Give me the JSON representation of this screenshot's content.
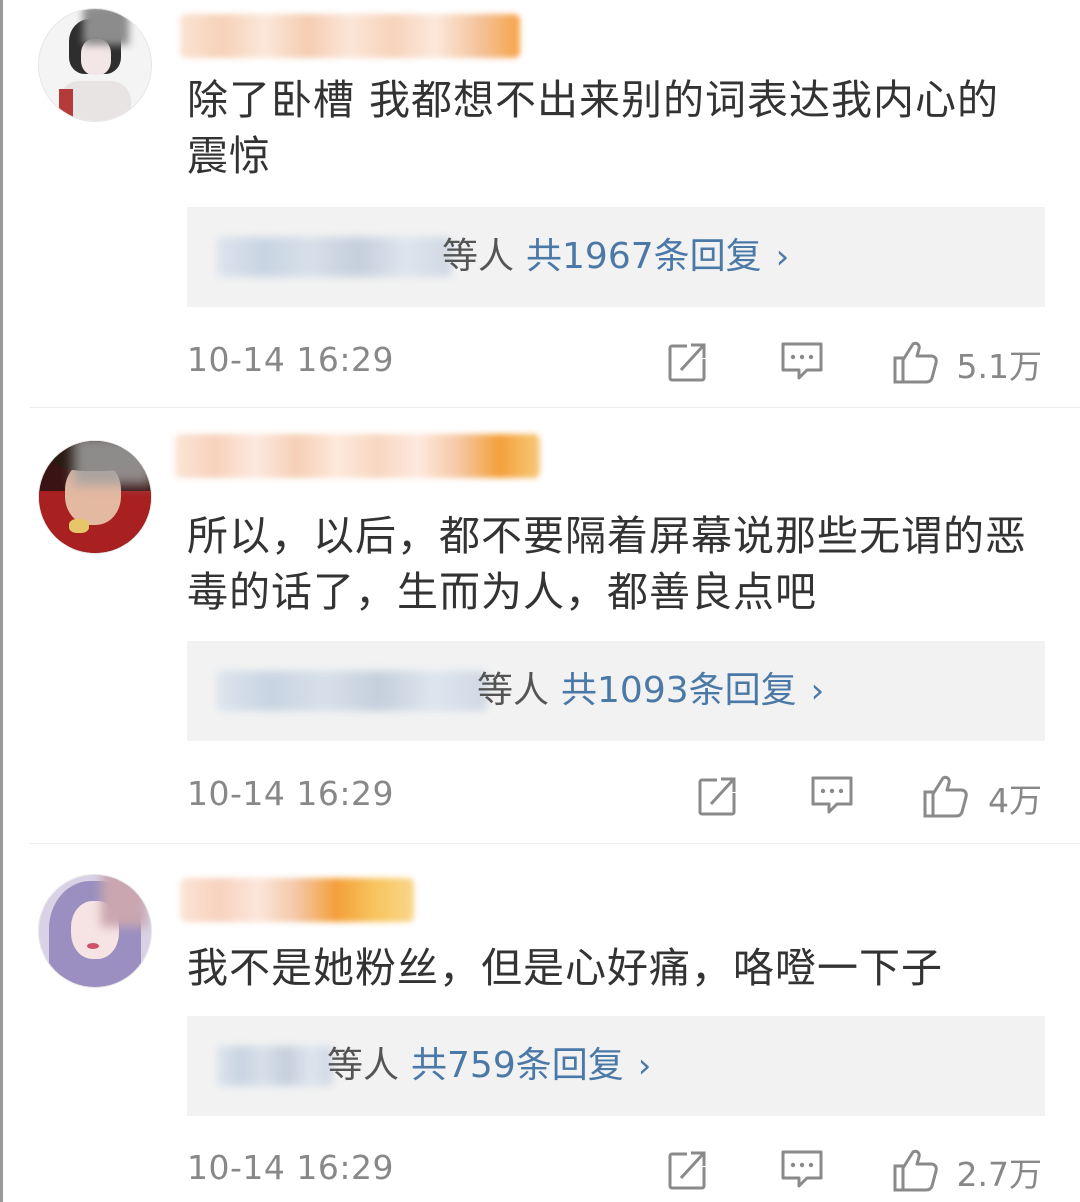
{
  "comments": [
    {
      "text": "除了卧槽 我都想不出来别的词表达我内心的震惊",
      "reply_who": "等人",
      "reply_count": "共1967条回复",
      "reply_chevron": "›",
      "time": "10-14 16:29",
      "likes": "5.1万"
    },
    {
      "text": "所以，以后，都不要隔着屏幕说那些无谓的恶毒的话了，生而为人，都善良点吧",
      "reply_who": "等人",
      "reply_count": "共1093条回复",
      "reply_chevron": "›",
      "time": "10-14 16:29",
      "likes": "4万"
    },
    {
      "text": "我不是她粉丝，但是心好痛，咯噔一下子",
      "reply_who": "等人",
      "reply_count": "共759条回复",
      "reply_chevron": "›",
      "time": "10-14 16:29",
      "likes": "2.7万"
    }
  ],
  "icons": {
    "forward": "share-icon",
    "comment": "comment-icon",
    "like": "thumbs-up-icon"
  },
  "colors": {
    "link": "#4a79a8",
    "meta": "#888888",
    "reply_bg": "#f2f2f2"
  }
}
